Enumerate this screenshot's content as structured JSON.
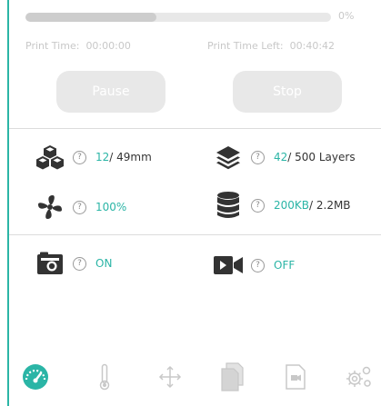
{
  "progress": {
    "percent_label": "0%",
    "fraction": 0.43
  },
  "print_time": {
    "label": "Print Time:",
    "value": "00:00:00"
  },
  "time_left": {
    "label": "Print Time Left:",
    "value": "00:40:42"
  },
  "buttons": {
    "pause": "Pause",
    "stop": "Stop"
  },
  "stats": {
    "layer_height": {
      "current": "12",
      "total": " / 49mm"
    },
    "layers": {
      "current": "42",
      "total": " / 500 Layers"
    },
    "fan": {
      "value": "100%"
    },
    "file_size": {
      "current": "200KB",
      "total": " / 2.2MB"
    },
    "camera": {
      "value": "ON"
    },
    "video": {
      "value": "OFF"
    }
  },
  "help_glyph": "?",
  "colors": {
    "accent": "#2bb5a6",
    "muted": "#e8e8e8",
    "icon_dark": "#333333",
    "nav_inactive": "#c8c8c8"
  },
  "nav": [
    "dashboard-icon",
    "thermometer-icon",
    "move-icon",
    "files-icon",
    "recording-file-icon",
    "settings-gears-icon"
  ]
}
